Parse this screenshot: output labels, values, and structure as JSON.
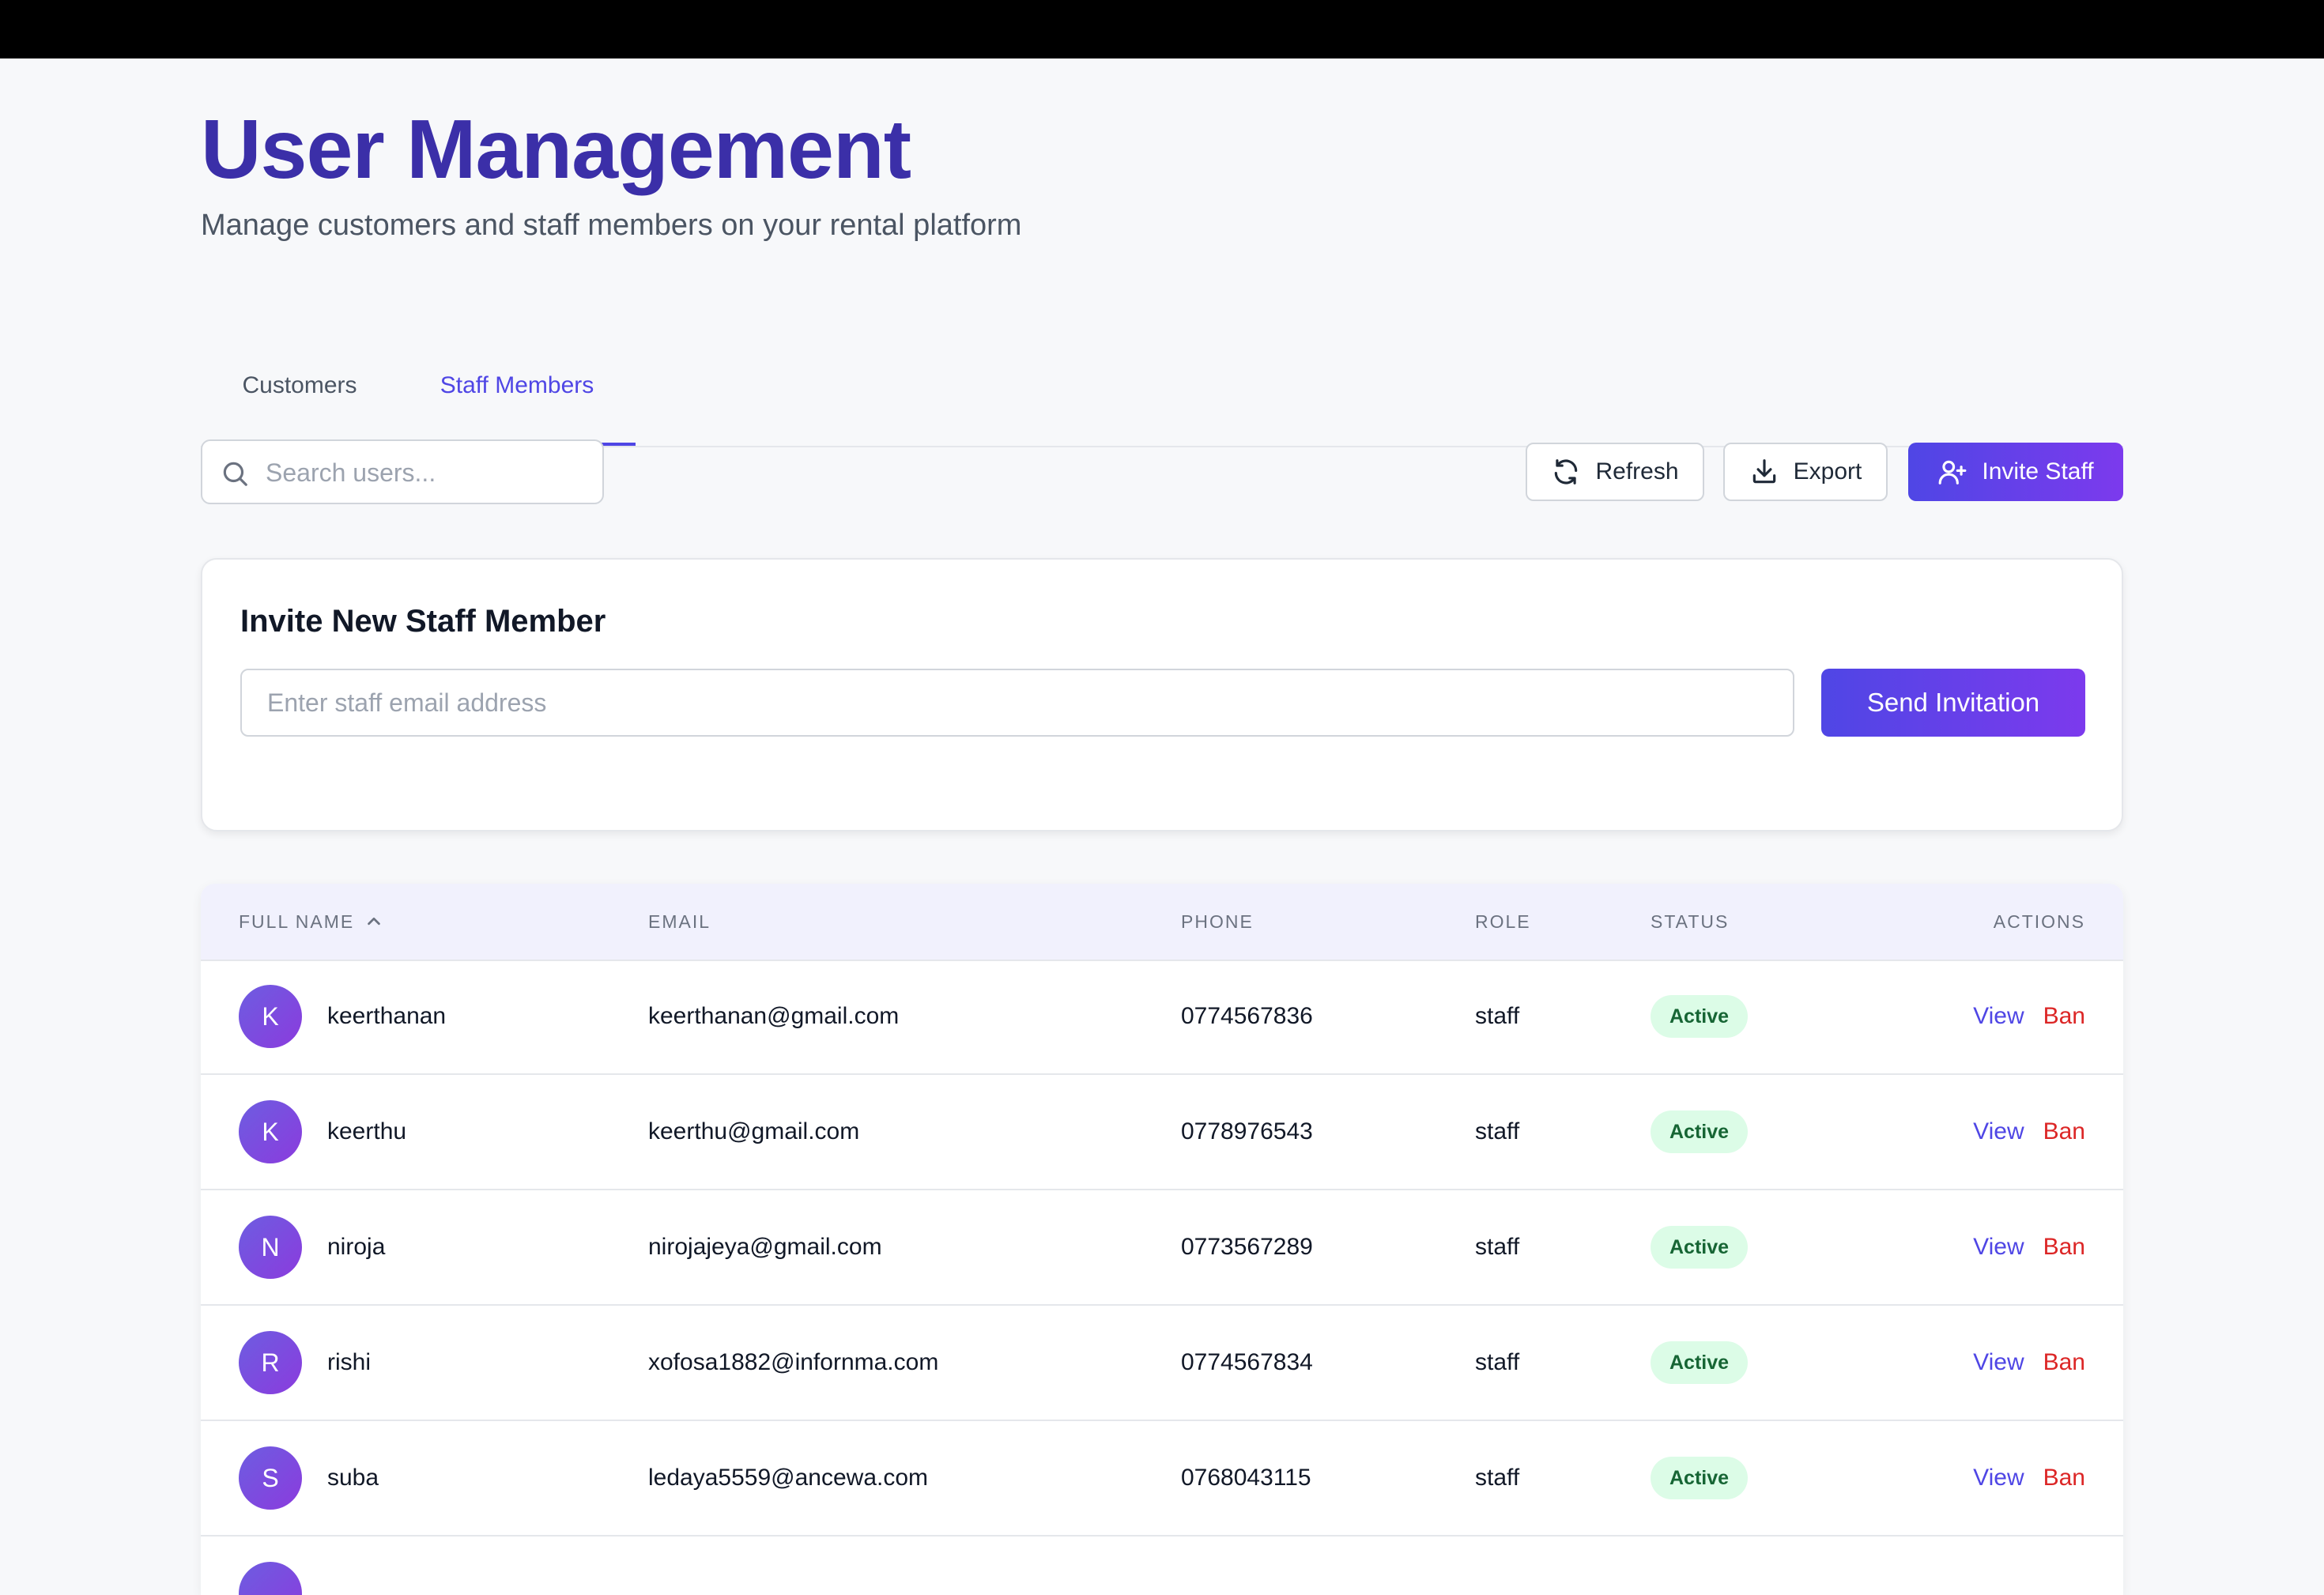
{
  "header": {
    "title": "User Management",
    "subtitle": "Manage customers and staff members on your rental platform"
  },
  "tabs": [
    {
      "label": "Customers",
      "active": false
    },
    {
      "label": "Staff Members",
      "active": true
    }
  ],
  "search": {
    "placeholder": "Search users...",
    "value": ""
  },
  "toolbar": {
    "refresh_label": "Refresh",
    "export_label": "Export",
    "invite_label": "Invite Staff"
  },
  "invite_card": {
    "title": "Invite New Staff Member",
    "email_placeholder": "Enter staff email address",
    "send_label": "Send Invitation"
  },
  "table": {
    "columns": [
      "FULL NAME",
      "EMAIL",
      "PHONE",
      "ROLE",
      "STATUS",
      "ACTIONS"
    ],
    "sort": {
      "column": "FULL NAME",
      "direction": "ascending"
    },
    "rows": [
      {
        "initial": "K",
        "name": "keerthanan",
        "email": "keerthanan@gmail.com",
        "phone": "0774567836",
        "role": "staff",
        "status": "Active",
        "view": "View",
        "ban": "Ban"
      },
      {
        "initial": "K",
        "name": "keerthu",
        "email": "keerthu@gmail.com",
        "phone": "0778976543",
        "role": "staff",
        "status": "Active",
        "view": "View",
        "ban": "Ban"
      },
      {
        "initial": "N",
        "name": "niroja",
        "email": "nirojajeya@gmail.com",
        "phone": "0773567289",
        "role": "staff",
        "status": "Active",
        "view": "View",
        "ban": "Ban"
      },
      {
        "initial": "R",
        "name": "rishi",
        "email": "xofosa1882@infornma.com",
        "phone": "0774567834",
        "role": "staff",
        "status": "Active",
        "view": "View",
        "ban": "Ban"
      },
      {
        "initial": "S",
        "name": "suba",
        "email": "ledaya5559@ancewa.com",
        "phone": "0768043115",
        "role": "staff",
        "status": "Active",
        "view": "View",
        "ban": "Ban"
      }
    ]
  },
  "colors": {
    "accent": "#4f46e5",
    "title": "#3b2fa8",
    "status_active_bg": "#dcfce7",
    "status_active_text": "#166534",
    "ban": "#dc2626"
  }
}
